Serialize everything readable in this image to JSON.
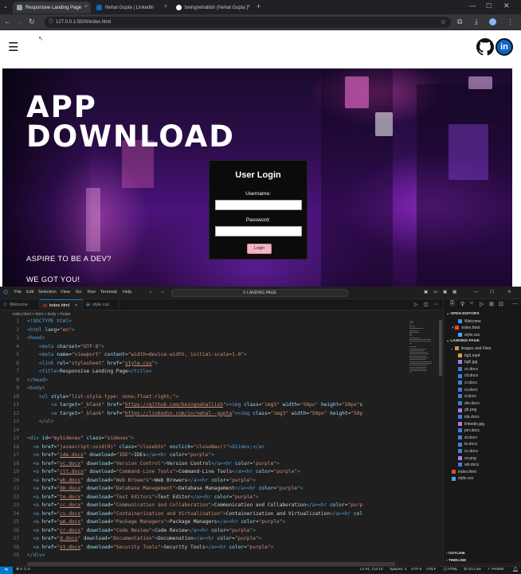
{
  "browser": {
    "tabs": [
      {
        "label": "Responsive Landing Page",
        "active": true
      },
      {
        "label": "Nehal Gupta | LinkedIn",
        "active": false
      },
      {
        "label": "beingnehallish (Nehal Gupta )",
        "active": false
      }
    ],
    "new_tab": "+",
    "url": "127.0.0.1:5500/index.html"
  },
  "site": {
    "menu_icon": "☰",
    "github_icon": "github-icon",
    "linkedin_icon": "linkedin-icon",
    "linkedin_text": "in",
    "hero_line1": "APP",
    "hero_line2": "DOWNLOAD",
    "login": {
      "heading": "User Login",
      "username_label": "Username:",
      "password_label": "Password:",
      "button": "Login"
    },
    "tagline1": "ASPIRE TO BE A DEV?",
    "tagline2": "WE GOT YOU!"
  },
  "vscode": {
    "menus": [
      "File",
      "Edit",
      "Selection",
      "View",
      "Go",
      "Run",
      "Terminal",
      "Help"
    ],
    "command_center": "LANDING PAGE",
    "editor_tabs": [
      "Welcome",
      "index.html",
      "style.css"
    ],
    "breadcrumb": "index.html > html > body > footer",
    "code": [
      {
        "n": "1",
        "html": "<span class='tg'>&lt;!DOCTYPE html&gt;</span>"
      },
      {
        "n": "2",
        "html": "<span class='tg'>&lt;html</span> <span class='at'>lang</span>=<span class='st'>\"en\"</span><span class='tg'>&gt;</span>"
      },
      {
        "n": "3",
        "html": "<span class='tg'>&lt;head&gt;</span>"
      },
      {
        "n": "4",
        "html": "    <span class='tg'>&lt;meta</span> <span class='at'>charset</span>=<span class='st'>\"UTF-8\"</span><span class='tg'>&gt;</span>"
      },
      {
        "n": "5",
        "html": "    <span class='tg'>&lt;meta</span> <span class='at'>name</span>=<span class='st'>\"viewport\"</span> <span class='at'>content</span>=<span class='st'>\"width=device-width, initial-scale=1.0\"</span><span class='tg'>&gt;</span>"
      },
      {
        "n": "6",
        "html": "    <span class='tg'>&lt;link</span> <span class='at'>rel</span>=<span class='st'>\"stylesheet\"</span> <span class='at'>href</span>=<span class='st'>\"<span class='ur'>style.css</span>\"</span><span class='tg'>&gt;</span>"
      },
      {
        "n": "7",
        "html": "    <span class='tg'>&lt;title&gt;</span>Responsive Landing Page<span class='tg'>&lt;/title&gt;</span>"
      },
      {
        "n": "8",
        "html": "<span class='tg'>&lt;/head&gt;</span>"
      },
      {
        "n": "9",
        "html": "<span class='tg'>&lt;body&gt;</span>"
      },
      {
        "n": "10",
        "html": "    <span class='tg'>&lt;ul</span> <span class='at'>style</span>=<span class='st'>\"list-style-type: none;float:right;\"</span><span class='tg'>&gt;</span>"
      },
      {
        "n": "11",
        "html": "        <span class='tg'>&lt;a</span> <span class='at'>target</span>=<span class='st'>\"_blank\"</span> <span class='at'>href</span>=<span class='st'>\"<span class='ur'>https://github.com/beingnehallish</span>\"</span><span class='tg'>&gt;&lt;img</span> <span class='at'>class</span>=<span class='st'>\"img3\"</span> <span class='at'>width</span>=<span class='st'>\"50px\"</span> <span class='at'>height</span>=<span class='st'>\"50px\"</span><span class='at'>s</span>"
      },
      {
        "n": "12",
        "html": "        <span class='tg'>&lt;a</span> <span class='at'>target</span>=<span class='st'>\"_blank\"</span> <span class='at'>href</span>=<span class='st'>\"<span class='ur'>https://linkedin.com/in/nehal--gupta</span>\"</span><span class='tg'>&gt;&lt;img</span> <span class='at'>class</span>=<span class='st'>\"img3\"</span> <span class='at'>width</span>=<span class='st'>\"50px\"</span> <span class='at'>height</span>=<span class='st'>\"50p</span>"
      },
      {
        "n": "13",
        "html": "    <span class='tg'>&lt;/ul&gt;</span>"
      },
      {
        "n": "14",
        "html": ""
      },
      {
        "n": "15",
        "html": "<span class='tg'>&lt;div</span> <span class='at'>id</span>=<span class='st'>\"mySidenav\"</span> <span class='at'>class</span>=<span class='st'>\"sidenav\"</span><span class='tg'>&gt;</span>"
      },
      {
        "n": "16",
        "html": "  <span class='tg'>&lt;a</span> <span class='at'>href</span>=<span class='st'>\"javascript:void(0)\"</span> <span class='at'>class</span>=<span class='st'>\"closebtn\"</span> <span class='at'>onclick</span>=<span class='st'>\"closeNav()\"</span><span class='tg'>&gt;</span><span class='en'>&amp;times;</span><span class='tg'>&lt;/a&gt;</span>"
      },
      {
        "n": "17",
        "html": "  <span class='tg'>&lt;a</span> <span class='at'>href</span>=<span class='st'>\"<span class='ur'>ide.docx</span>\"</span> <span class='at'>download</span>=<span class='st'>\"IDE\"</span><span class='tg'>&gt;</span>IDEs<span class='tg'>&lt;/a&gt;&lt;hr</span> <span class='at'>color</span>=<span class='st'>\"purple\"</span><span class='tg'>&gt;</span>"
      },
      {
        "n": "18",
        "html": "  <span class='tg'>&lt;a</span> <span class='at'>href</span>=<span class='st'>\"<span class='ur'>vc.docx</span>\"</span> <span class='at'>download</span>=<span class='st'>\"Version Control\"</span><span class='tg'>&gt;</span>Version Control<span class='tg'>&lt;/a&gt;&lt;hr</span> <span class='at'>color</span>=<span class='st'>\"purple\"</span><span class='tg'>&gt;</span>"
      },
      {
        "n": "19",
        "html": "  <span class='tg'>&lt;a</span> <span class='at'>href</span>=<span class='st'>\"<span class='ur'>clt.docx</span>\"</span> <span class='at'>download</span>=<span class='st'>\"Command-Line Tools\"</span><span class='tg'>&gt;</span>Command-Line Tools<span class='tg'>&lt;/a&gt;&lt;hr</span> <span class='at'>color</span>=<span class='st'>\"purple\"</span><span class='tg'>&gt;</span>"
      },
      {
        "n": "20",
        "html": "  <span class='tg'>&lt;a</span> <span class='at'>href</span>=<span class='st'>\"<span class='ur'>wb.docx</span>\"</span> <span class='at'>download</span>=<span class='st'>\"Web Browers\"</span><span class='tg'>&gt;</span>Web Browers<span class='tg'>&lt;/a&gt;&lt;hr</span> <span class='at'>color</span>=<span class='st'>\"purple\"</span><span class='tg'>&gt;</span>"
      },
      {
        "n": "21",
        "html": "  <span class='tg'>&lt;a</span> <span class='at'>href</span>=<span class='st'>\"<span class='ur'>dm.docx</span>\"</span> <span class='at'>download</span>=<span class='st'>\"Database Management\"</span><span class='tg'>&gt;</span>Database Management<span class='tg'>&lt;/a&gt;&lt;hr</span> <span class='at'>color</span>=<span class='st'>\"purple\"</span><span class='tg'>&gt;</span>"
      },
      {
        "n": "22",
        "html": "  <span class='tg'>&lt;a</span> <span class='at'>href</span>=<span class='st'>\"<span class='ur'>te.docx</span>\"</span> <span class='at'>download</span>=<span class='st'>\"Text Editors\"</span><span class='tg'>&gt;</span>Text Editor<span class='tg'>&lt;/a&gt;&lt;hr</span> <span class='at'>color</span>=<span class='st'>\"purple\"</span><span class='tg'>&gt;</span>"
      },
      {
        "n": "23",
        "html": "  <span class='tg'>&lt;a</span> <span class='at'>href</span>=<span class='st'>\"<span class='ur'>cc.docx</span>\"</span> <span class='at'>download</span>=<span class='st'>\"Communication and Collaboration\"</span><span class='tg'>&gt;</span>Communication and Collaboration<span class='tg'>&lt;/a&gt;&lt;hr</span> <span class='at'>color</span>=<span class='st'>\"purp</span>"
      },
      {
        "n": "24",
        "html": "  <span class='tg'>&lt;a</span> <span class='at'>href</span>=<span class='st'>\"<span class='ur'>cv.docx</span>\"</span> <span class='at'>download</span>=<span class='st'>\"Containerization and Virtualization\"</span><span class='tg'>&gt;</span>Containerization and Virtualization<span class='tg'>&lt;/a&gt;&lt;hr</span> <span class='at'>col</span>"
      },
      {
        "n": "25",
        "html": "  <span class='tg'>&lt;a</span> <span class='at'>href</span>=<span class='st'>\"<span class='ur'>pm.docx</span>\"</span> <span class='at'>download</span>=<span class='st'>\"Package Managers\"</span><span class='tg'>&gt;</span>Package Managers<span class='tg'>&lt;/a&gt;&lt;hr</span> <span class='at'>color</span>=<span class='st'>\"purple\"</span><span class='tg'>&gt;</span>"
      },
      {
        "n": "26",
        "html": "  <span class='tg'>&lt;a</span> <span class='at'>href</span>=<span class='st'>\"<span class='ur'>cr.docx</span>\"</span> <span class='at'>download</span>=<span class='st'>\"Code Review\"</span><span class='tg'>&gt;</span>Code Review<span class='tg'>&lt;/a&gt;&lt;hr</span> <span class='at'>color</span>=<span class='st'>\"purple\"</span><span class='tg'>&gt;</span>"
      },
      {
        "n": "27",
        "html": "  <span class='tg'>&lt;a</span> <span class='at'>href</span>=<span class='st'>\"<span class='ur'>d.docx</span>\"</span> <span class='at'>download</span>=<span class='st'>\"Documentation\"</span><span class='tg'>&gt;</span>Documenation<span class='tg'>&lt;/a&gt;&lt;hr</span> <span class='at'>color</span>=<span class='st'>\"purple\"</span><span class='tg'>&gt;</span>"
      },
      {
        "n": "28",
        "html": "  <span class='tg'>&lt;a</span> <span class='at'>href</span>=<span class='st'>\"<span class='ur'>st.docx</span>\"</span> <span class='at'>download</span>=<span class='st'>\"Security Tools\"</span><span class='tg'>&gt;</span>Security Tools<span class='tg'>&lt;/a&gt;&lt;hr</span> <span class='at'>color</span>=<span class='st'>\"purple\"</span><span class='tg'>&gt;</span>"
      },
      {
        "n": "29",
        "html": "<span class='tg'>&lt;/div&gt;</span>"
      }
    ],
    "explorer": {
      "open_editors": "OPEN EDITORS",
      "open_files": [
        {
          "name": "Welcome",
          "color": "#3794ff",
          "x": false
        },
        {
          "name": "index.html",
          "color": "#e44d26",
          "x": true
        },
        {
          "name": "style.css",
          "color": "#42a5f5",
          "x": false
        }
      ],
      "project": "LANDING PAGE",
      "folder": "images and Files",
      "files": [
        {
          "name": "bg3.mp4",
          "color": "#e0a030"
        },
        {
          "name": "bg5.jpg",
          "color": "#b07cd8"
        },
        {
          "name": "cc.docx",
          "color": "#3f7fd8"
        },
        {
          "name": "clt.docx",
          "color": "#3f7fd8"
        },
        {
          "name": "cr.docx",
          "color": "#3f7fd8"
        },
        {
          "name": "cv.docx",
          "color": "#3f7fd8"
        },
        {
          "name": "d.docx",
          "color": "#3f7fd8"
        },
        {
          "name": "dm.docx",
          "color": "#3f7fd8"
        },
        {
          "name": "gh.png",
          "color": "#b07cd8"
        },
        {
          "name": "ide.docx",
          "color": "#3f7fd8"
        },
        {
          "name": "linkedin.jpg",
          "color": "#b07cd8"
        },
        {
          "name": "pm.docx",
          "color": "#3f7fd8"
        },
        {
          "name": "st.docx",
          "color": "#3f7fd8"
        },
        {
          "name": "te.docx",
          "color": "#3f7fd8"
        },
        {
          "name": "vc.docx",
          "color": "#3f7fd8"
        },
        {
          "name": "vs.png",
          "color": "#b07cd8"
        },
        {
          "name": "wb.docx",
          "color": "#3f7fd8"
        }
      ],
      "root_files": [
        {
          "name": "index.html",
          "color": "#e44d26"
        },
        {
          "name": "style.css",
          "color": "#42a5f5"
        }
      ],
      "outline": "OUTLINE",
      "timeline": "TIMELINE"
    },
    "status": {
      "left": "⊗ 0 ⚠ 0",
      "position": "Ln 91, Col 10",
      "spaces": "Spaces: 4",
      "encoding": "UTF-8",
      "eol": "CRLF",
      "language": "{} HTML",
      "golive": "⊘ Go Live",
      "prettier": "✓ Prettier"
    }
  }
}
